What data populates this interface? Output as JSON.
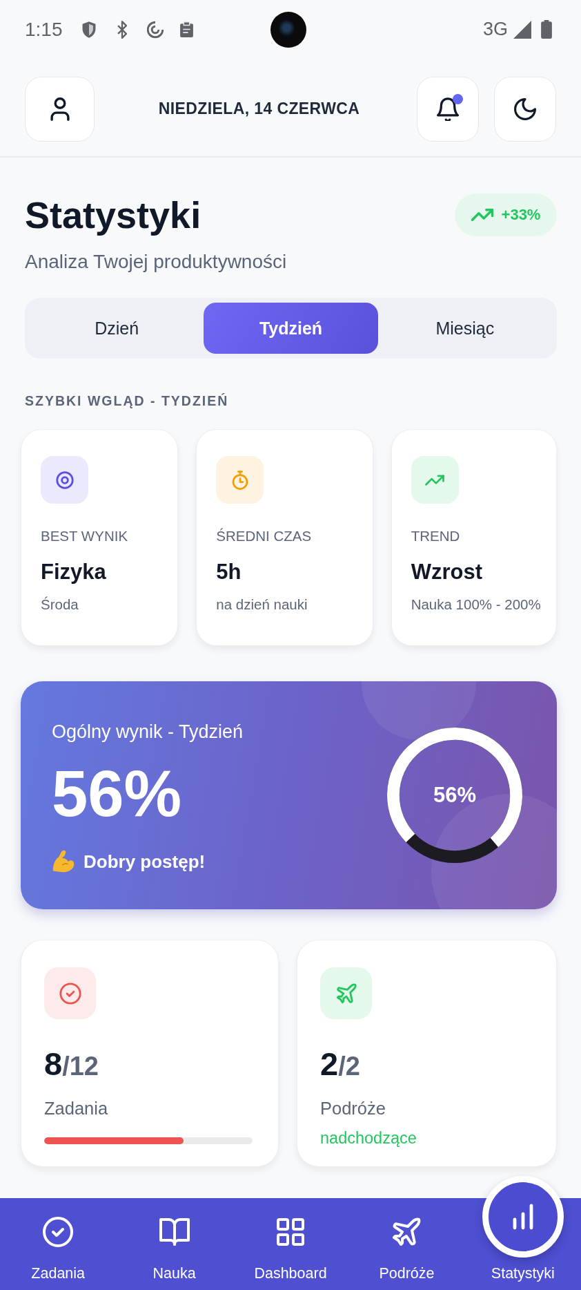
{
  "status_bar": {
    "time": "1:15",
    "network": "3G"
  },
  "header": {
    "date": "NIEDZIELA, 14 CZERWCA",
    "notification_dot": true
  },
  "title": {
    "heading": "Statystyki",
    "subtitle": "Analiza Twojej produktywności",
    "trend": "+33%"
  },
  "period_tabs": [
    {
      "label": "Dzień",
      "selected": false
    },
    {
      "label": "Tydzień",
      "selected": true
    },
    {
      "label": "Miesiąc",
      "selected": false
    }
  ],
  "quick_view": {
    "heading": "SZYBKI WGLĄD - TYDZIEŃ",
    "cards": [
      {
        "kind": "target",
        "color": "#5b4ee5",
        "label": "BEST WYNIK",
        "value": "Fizyka",
        "detail": "Środa"
      },
      {
        "kind": "timer",
        "color": "#f59e0b",
        "label": "ŚREDNI CZAS",
        "value": "5h",
        "detail": "na dzień nauki"
      },
      {
        "kind": "trend",
        "color": "#22c55e",
        "label": "TREND",
        "value": "Wzrost",
        "detail": "Nauka 100% - 200%"
      }
    ]
  },
  "score": {
    "title": "Ogólny wynik - Tydzień",
    "value": "56%",
    "message": "Dobry postęp!",
    "ring": {
      "label": "56%",
      "level": 0.76
    }
  },
  "summary_cards": [
    {
      "kind": "tasks",
      "color": "#ef5350",
      "count": "8",
      "total": "/12",
      "label": "Zadania",
      "progress": {
        "level": 0.67
      }
    },
    {
      "kind": "trips",
      "color": "#22c55e",
      "count": "2",
      "total": "/2",
      "label": "Podróże",
      "note": "nadchodzące"
    }
  ],
  "bottom_nav": [
    {
      "kind": "tasks",
      "label": "Zadania",
      "selected": false
    },
    {
      "kind": "learning",
      "label": "Nauka",
      "selected": false
    },
    {
      "kind": "dashboard",
      "label": "Dashboard",
      "selected": false
    },
    {
      "kind": "trips",
      "label": "Podróże",
      "selected": false
    },
    {
      "kind": "stats",
      "label": "Statystyki",
      "selected": true
    }
  ]
}
